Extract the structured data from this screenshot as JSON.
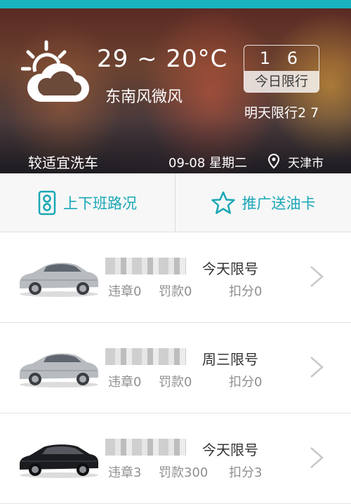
{
  "weather": {
    "icon": "partly-cloudy-icon",
    "temperature": "29 ~ 20°C",
    "wind": "东南风微风",
    "wash_index": "较适宜洗车",
    "date": "09-08 星期二",
    "city": "天津市"
  },
  "restriction": {
    "today_numbers": "1 6",
    "today_label": "今日限行",
    "tomorrow": "明天限行2 7"
  },
  "quick_actions": {
    "traffic_label": "上下班路况",
    "traffic_icon": "traffic-light-icon",
    "promo_label": "推广送油卡",
    "promo_icon": "star-icon"
  },
  "cars": [
    {
      "limit": "今天限号",
      "violations": "违章0",
      "fines": "罚款0",
      "points": "扣分0",
      "car_color": "silver"
    },
    {
      "limit": "周三限号",
      "violations": "违章0",
      "fines": "罚款0",
      "points": "扣分0",
      "car_color": "silver"
    },
    {
      "limit": "今天限号",
      "violations": "违章3",
      "fines": "罚款300",
      "points": "扣分3",
      "car_color": "black"
    }
  ],
  "colors": {
    "accent": "#19b2bf",
    "accent_text": "#1aa7b6"
  }
}
